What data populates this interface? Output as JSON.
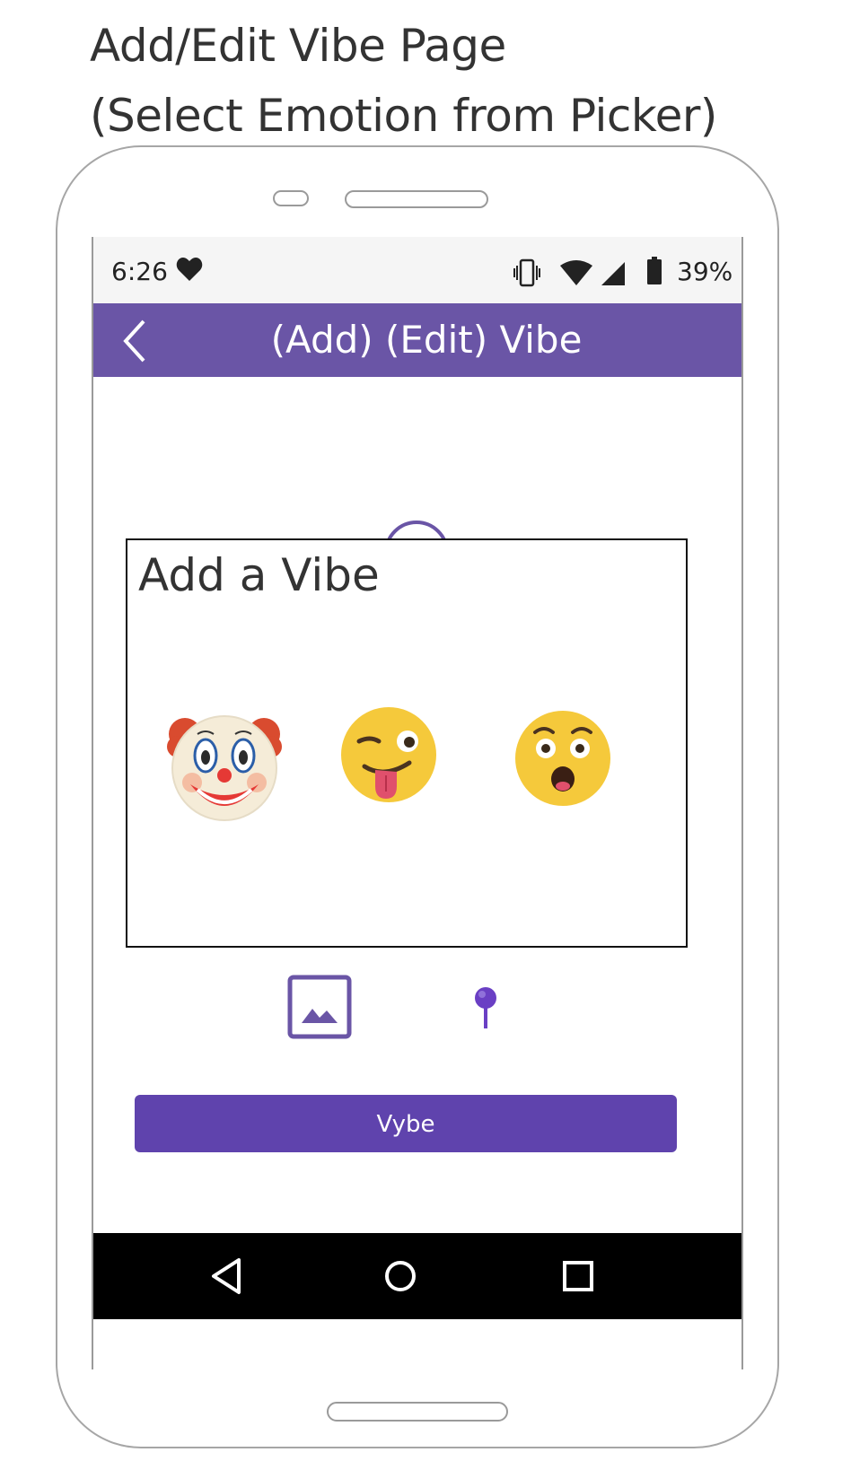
{
  "heading": {
    "line1": "Add/Edit Vibe Page",
    "line2": "(Select Emotion from Picker)"
  },
  "status_bar": {
    "time": "6:26",
    "battery": "39%",
    "icons": [
      "heart-icon",
      "vibrate-icon",
      "wifi-icon",
      "signal-icon",
      "battery-icon"
    ]
  },
  "app_bar": {
    "title": "(Add) (Edit) Vibe",
    "color": "#6a55a6"
  },
  "picker": {
    "title": "Add a Vibe",
    "emotions": [
      "clown-face-emoji",
      "winking-face-with-tongue-emoji",
      "astonished-face-emoji"
    ]
  },
  "actions": {
    "submit_label": "Vybe",
    "accent": "#5f43ad"
  },
  "nav_bar": {
    "icons": [
      "nav-back-icon",
      "nav-home-icon",
      "nav-recent-icon"
    ]
  }
}
